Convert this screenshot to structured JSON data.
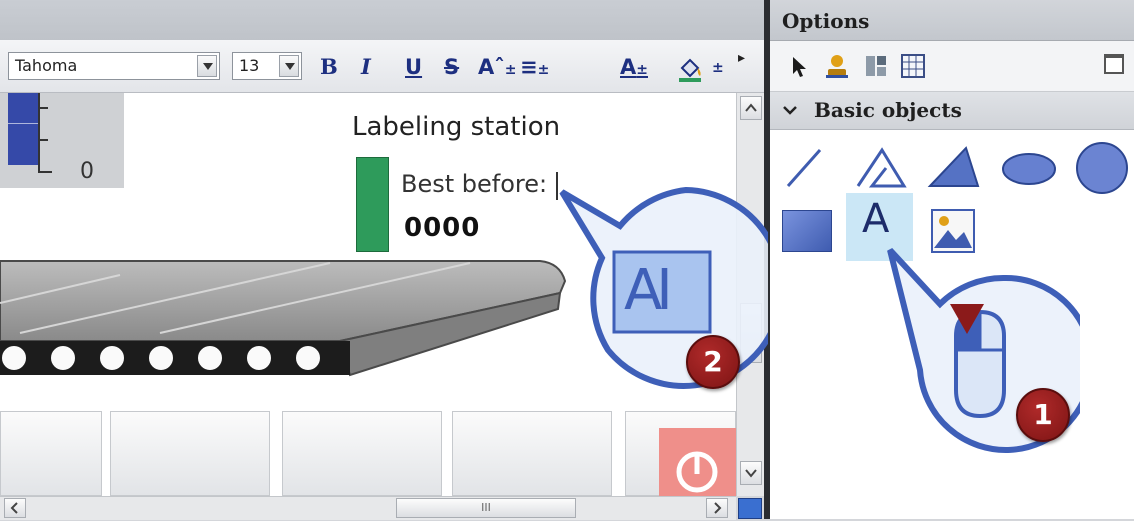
{
  "toolbar": {
    "font_name": "Tahoma",
    "font_size": "13",
    "bold": "B",
    "italic": "I",
    "underline": "U",
    "strike": "S",
    "pm": "±",
    "more": "▸"
  },
  "canvas": {
    "gauge_zero": "0",
    "station_title": "Labeling station",
    "best_before_label": "Best before:",
    "counter_value": "0000"
  },
  "callouts": {
    "text_tool_glyph": "AI",
    "step1": "1",
    "step2": "2"
  },
  "options": {
    "title": "Options",
    "basic_objects": "Basic objects",
    "text_object_glyph": "A"
  },
  "scroll": {
    "thumb_grip": "III"
  },
  "colors": {
    "accent_blue": "#3549a8",
    "status_green": "#2e9b5b",
    "badge_red": "#8b1a1a",
    "callout_blue": "#3e5fb8"
  }
}
